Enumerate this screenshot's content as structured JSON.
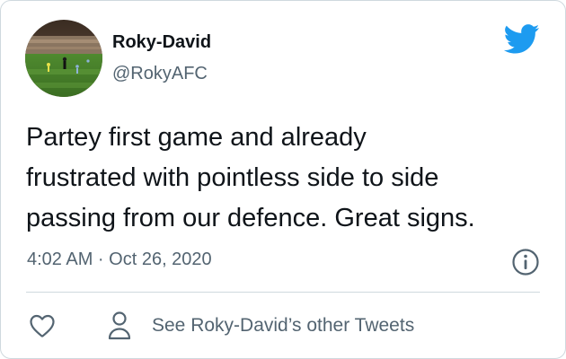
{
  "author": {
    "name": "Roky-David",
    "handle": "@RokyAFC"
  },
  "tweet": {
    "text": "Partey first game and already\nfrustrated with pointless side to side\npassing from our defence. Great signs.",
    "timestamp": "4:02 AM · Oct 26, 2020"
  },
  "actions": {
    "profile_label": "See Roky-David’s other Tweets"
  },
  "icons": {
    "brand": "twitter-bird-icon",
    "info": "info-icon",
    "like": "heart-icon",
    "profile": "person-icon"
  },
  "colors": {
    "brand_blue": "#1d9bf0",
    "text_primary": "#0f1419",
    "text_secondary": "#536471",
    "border": "#cfd9de"
  }
}
